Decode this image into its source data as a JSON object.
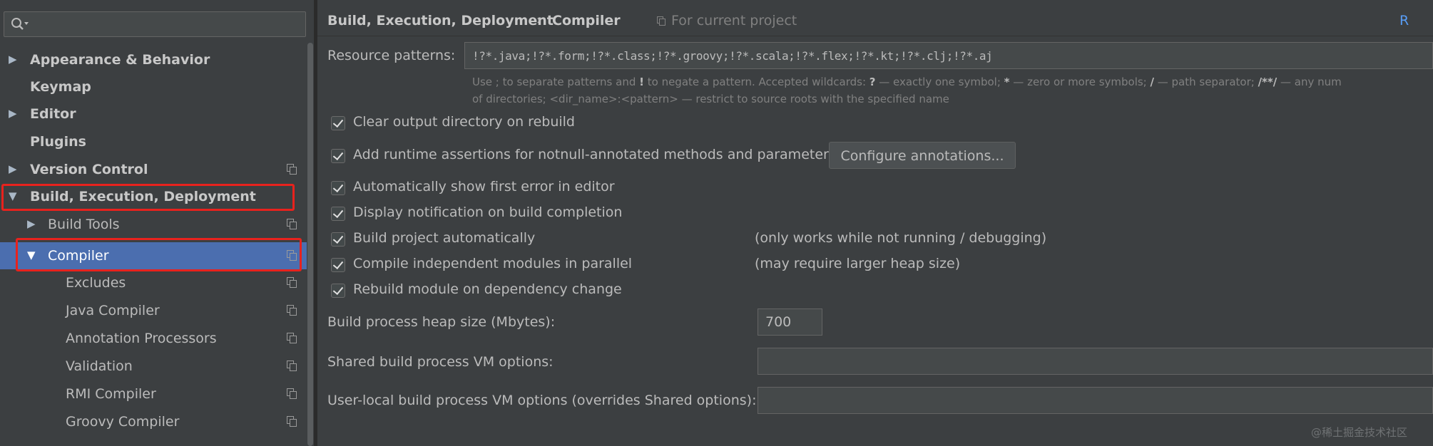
{
  "sidebar": {
    "search": {
      "value": "",
      "placeholder": ""
    },
    "items": [
      {
        "label": "Appearance & Behavior",
        "arrow": "▶",
        "bold": true
      },
      {
        "label": "Keymap",
        "arrow": "",
        "bold": true
      },
      {
        "label": "Editor",
        "arrow": "▶",
        "bold": true
      },
      {
        "label": "Plugins",
        "arrow": "",
        "bold": true
      },
      {
        "label": "Version Control",
        "arrow": "▶",
        "bold": true
      },
      {
        "label": "Build, Execution, Deployment",
        "arrow": "▼",
        "bold": true
      },
      {
        "label": "Build Tools",
        "arrow": "▶",
        "bold": false
      },
      {
        "label": "Compiler",
        "arrow": "▼",
        "bold": false,
        "selected": true
      },
      {
        "label": "Excludes",
        "arrow": "",
        "bold": false
      },
      {
        "label": "Java Compiler",
        "arrow": "",
        "bold": false
      },
      {
        "label": "Annotation Processors",
        "arrow": "",
        "bold": false
      },
      {
        "label": "Validation",
        "arrow": "",
        "bold": false
      },
      {
        "label": "RMI Compiler",
        "arrow": "",
        "bold": false
      },
      {
        "label": "Groovy Compiler",
        "arrow": "",
        "bold": false
      }
    ]
  },
  "header": {
    "breadcrumb": [
      "Build, Execution, Deployment",
      "Compiler"
    ],
    "separator": "›",
    "scope": "For current project",
    "reset": "R"
  },
  "resource_patterns": {
    "label": "Resource patterns:",
    "value": "!?*.java;!?*.form;!?*.class;!?*.groovy;!?*.scala;!?*.flex;!?*.kt;!?*.clj;!?*.aj",
    "hint_line1_a": "Use ; to separate patterns and ",
    "hint_line1_b": "!",
    "hint_line1_c": " to negate a pattern. Accepted wildcards: ",
    "hint_line1_d": "?",
    "hint_line1_e": " — exactly one symbol; ",
    "hint_line1_f": "*",
    "hint_line1_g": " — zero or more symbols; ",
    "hint_line1_h": "/",
    "hint_line1_i": " — path separator; ",
    "hint_line1_j": "/**/",
    "hint_line1_k": " — any num",
    "hint_line2": "of directories; <dir_name>:<pattern> — restrict to source roots with the specified name"
  },
  "options": [
    {
      "label": "Clear output directory on rebuild",
      "checked": true
    },
    {
      "label": "Add runtime assertions for notnull-annotated methods and parameters",
      "checked": true
    },
    {
      "label": "Automatically show first error in editor",
      "checked": true
    },
    {
      "label": "Display notification on build completion",
      "checked": true
    },
    {
      "label": "Build project automatically",
      "checked": true,
      "note": "(only works while not running / debugging)"
    },
    {
      "label": "Compile independent modules in parallel",
      "checked": true,
      "note": "(may require larger heap size)"
    },
    {
      "label": "Rebuild module on dependency change",
      "checked": true
    }
  ],
  "configure_button": "Configure annotations...",
  "heap": {
    "label": "Build process heap size (Mbytes):",
    "value": "700"
  },
  "shared_vm": {
    "label": "Shared build process VM options:",
    "value": ""
  },
  "user_vm": {
    "label": "User-local build process VM options (overrides Shared options):",
    "value": ""
  },
  "watermark": "@稀土掘金技术社区",
  "colors": {
    "background": "#3c3f41",
    "selection": "#4b6eaf",
    "link": "#589df6",
    "annotation": "#e8221d"
  }
}
